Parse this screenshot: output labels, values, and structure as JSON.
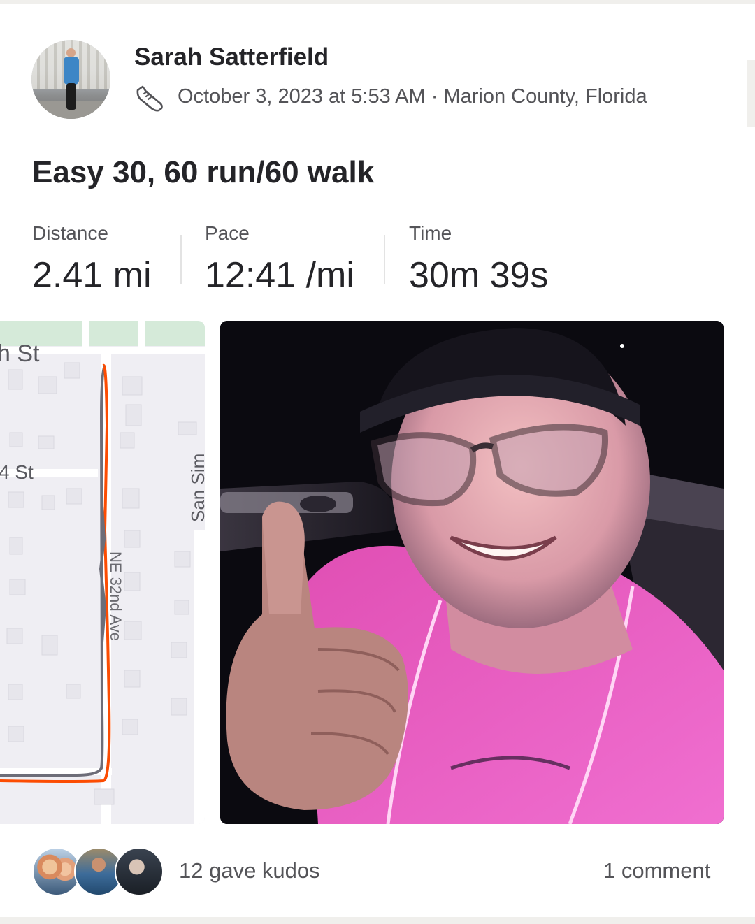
{
  "athlete": {
    "name": "Sarah Satterfield",
    "activity_icon": "shoe-icon",
    "meta": "October 3, 2023 at 5:53 AM · Marion County, Florida"
  },
  "activity": {
    "title": "Easy 30, 60 run/60 walk"
  },
  "stats": [
    {
      "label": "Distance",
      "value": "2.41 mi"
    },
    {
      "label": "Pace",
      "value": "12:41 /mi"
    },
    {
      "label": "Time",
      "value": "30m 39s"
    }
  ],
  "map": {
    "street_labels": [
      "h St",
      "4 St",
      "San Sim",
      "NE 32nd Ave"
    ],
    "route_colors": {
      "primary": "#fc4c02",
      "secondary": "#6d6d78"
    }
  },
  "social": {
    "kudos_text": "12 gave kudos",
    "comments_text": "1 comment"
  },
  "colors": {
    "accent": "#fc4c02",
    "text": "#242428",
    "muted": "#545458"
  }
}
